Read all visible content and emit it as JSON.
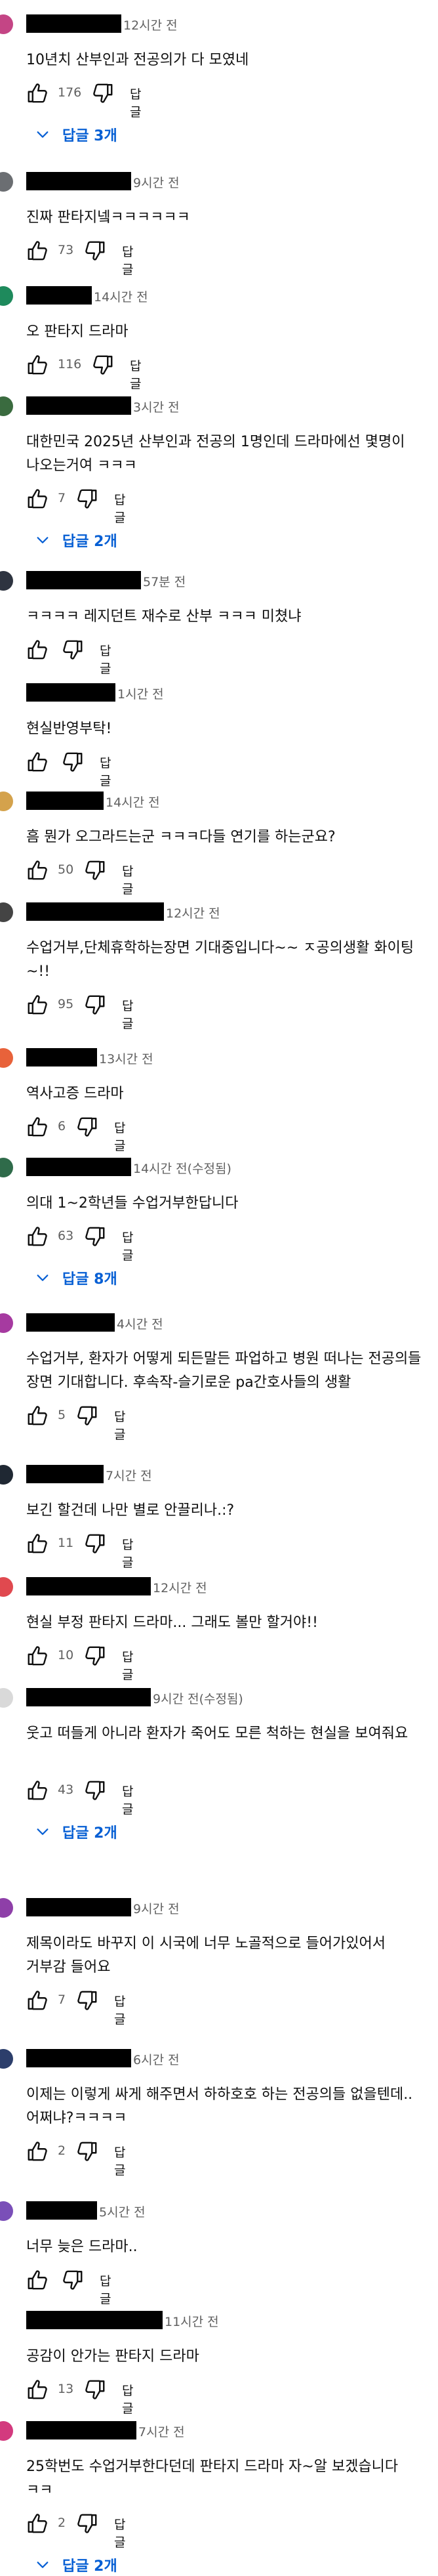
{
  "comments": [
    {
      "time": "12시간 전",
      "text": "10년치 산부인과 전공의가 다 모였네",
      "likes": "176",
      "reply_label": "답글",
      "replies": "답글 3개",
      "avatar_color": "#c44585"
    },
    {
      "time": "9시간 전",
      "text": "진짜 판타지넼ㅋㅋㅋㅋㅋㅋ",
      "likes": "73",
      "reply_label": "답글",
      "replies": "",
      "avatar_color": "#6b6e72"
    },
    {
      "time": "14시간 전",
      "text": "오 판타지 드라마",
      "likes": "116",
      "reply_label": "답글",
      "replies": "",
      "avatar_color": "#1e8a5c"
    },
    {
      "time": "3시간 전",
      "text": "대한민국 2025년 산부인과 전공의 1명인데 드라마에선 몇명이 나오는거여 ㅋㅋㅋ",
      "likes": "7",
      "reply_label": "답글",
      "replies": "답글 2개",
      "avatar_color": "#3a6b3f"
    },
    {
      "time": "57분 전",
      "text": "ㅋㅋㅋㅋ 레지던트 재수로 산부 ㅋㅋㅋ 미쳤냐",
      "likes": "",
      "reply_label": "답글",
      "replies": "",
      "avatar_color": "#2e3440"
    },
    {
      "time": "1시간 전",
      "text": "현실반영부탁!",
      "likes": "",
      "reply_label": "답글",
      "replies": "",
      "avatar_color": "#ffffff"
    },
    {
      "time": "14시간 전",
      "text": "흠 뭔가 오그라드는군 ㅋㅋㅋ다들 연기를 하는군요?",
      "likes": "50",
      "reply_label": "답글",
      "replies": "",
      "avatar_color": "#d4a24c"
    },
    {
      "time": "12시간 전",
      "text": "수업거부,단체휴학하는장면 기대중입니다~~ ㅈ공의생활 화이팅~!!",
      "likes": "95",
      "reply_label": "답글",
      "replies": "",
      "avatar_color": "#444444"
    },
    {
      "time": "13시간 전",
      "text": "역사고증 드라마",
      "likes": "6",
      "reply_label": "답글",
      "replies": "",
      "avatar_color": "#e8623a"
    },
    {
      "time": "14시간 전(수정됨)",
      "text": "의대 1~2학년들 수업거부한답니다",
      "likes": "63",
      "reply_label": "답글",
      "replies": "답글 8개",
      "avatar_color": "#2f6b4a"
    },
    {
      "time": "4시간 전",
      "text": "수업거부, 환자가 어떻게 되든말든 파업하고 병원 떠나는 전공의들 장면 기대합니다. 후속작-슬기로운 pa간호사들의 생활",
      "likes": "5",
      "reply_label": "답글",
      "replies": "",
      "avatar_color": "#a63aa0"
    },
    {
      "time": "7시간 전",
      "text": "보긴 할건데 나만 별로 안끌리나.:?",
      "likes": "11",
      "reply_label": "답글",
      "replies": "",
      "avatar_color": "#1f2833"
    },
    {
      "time": "12시간 전",
      "text": "현실 부정 판타지 드라마... 그래도 볼만 할거야!!",
      "likes": "10",
      "reply_label": "답글",
      "replies": "",
      "avatar_color": "#e0494f"
    },
    {
      "time": "9시간 전(수정됨)",
      "text": "웃고 떠들게 아니라 환자가 죽어도 모른 척하는 현실을 보여줘요",
      "likes": "43",
      "reply_label": "답글",
      "replies": "답글 2개",
      "avatar_color": "#d9d9d9"
    },
    {
      "time": "9시간 전",
      "text": "제목이라도 바꾸지 이 시국에 너무 노골적으로 들어가있어서 거부감 들어요",
      "likes": "7",
      "reply_label": "답글",
      "replies": "",
      "avatar_color": "#8e3fa8"
    },
    {
      "time": "6시간 전",
      "text": "이제는 이렇게 싸게 해주면서 하하호호 하는 전공의들 없을텐데.. 어쩌냐?ㅋㅋㅋㅋ",
      "likes": "2",
      "reply_label": "답글",
      "replies": "",
      "avatar_color": "#2c3e6b"
    },
    {
      "time": "5시간 전",
      "text": "너무 늦은 드라마..",
      "likes": "",
      "reply_label": "답글",
      "replies": "",
      "avatar_color": "#7a4fb8"
    },
    {
      "time": "11시간 전",
      "text": "공감이 안가는 판타지 드라마",
      "likes": "13",
      "reply_label": "답글",
      "replies": "",
      "avatar_color": "#ffffff"
    },
    {
      "time": "7시간 전",
      "text": "25학번도 수업거부한다던데 판타지 드라마 자~알 보겠습니다 ㅋㅋ",
      "likes": "2",
      "reply_label": "답글",
      "replies": "답글 2개",
      "avatar_color": "#d33a7e"
    }
  ]
}
